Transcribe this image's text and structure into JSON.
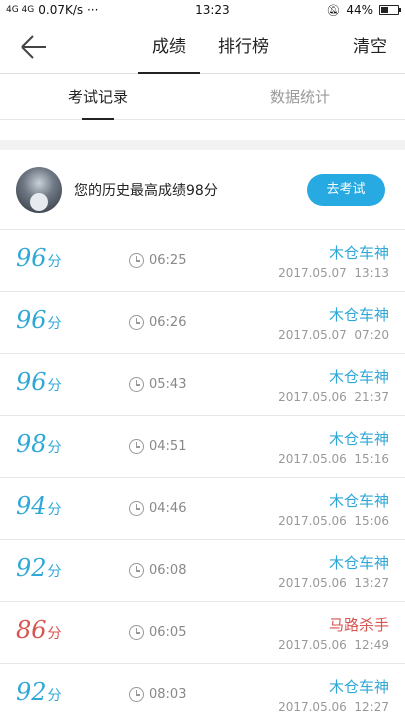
{
  "status_bar": {
    "left_text": "0.07K/s ···",
    "network": "4G 4G",
    "time": "13:23",
    "battery": "44%",
    "battery_level": 0.44
  },
  "nav": {
    "back_icon": "arrow-left-icon",
    "tabs": [
      {
        "label": "成绩",
        "active": true
      },
      {
        "label": "排行榜",
        "active": false
      }
    ],
    "clear_label": "清空"
  },
  "sub_tabs": [
    {
      "label": "考试记录",
      "active": true
    },
    {
      "label": "数据统计",
      "active": false
    }
  ],
  "best": {
    "text": "您的历史最高成绩98分",
    "button": "去考试"
  },
  "records": [
    {
      "score": "96",
      "unit": "分",
      "duration": "06:25",
      "title": "木仓车神",
      "datetime": "2017.05.07  13:13",
      "low": false
    },
    {
      "score": "96",
      "unit": "分",
      "duration": "06:26",
      "title": "木仓车神",
      "datetime": "2017.05.07  07:20",
      "low": false
    },
    {
      "score": "96",
      "unit": "分",
      "duration": "05:43",
      "title": "木仓车神",
      "datetime": "2017.05.06  21:37",
      "low": false
    },
    {
      "score": "98",
      "unit": "分",
      "duration": "04:51",
      "title": "木仓车神",
      "datetime": "2017.05.06  15:16",
      "low": false
    },
    {
      "score": "94",
      "unit": "分",
      "duration": "04:46",
      "title": "木仓车神",
      "datetime": "2017.05.06  15:06",
      "low": false
    },
    {
      "score": "92",
      "unit": "分",
      "duration": "06:08",
      "title": "木仓车神",
      "datetime": "2017.05.06  13:27",
      "low": false
    },
    {
      "score": "86",
      "unit": "分",
      "duration": "06:05",
      "title": "马路杀手",
      "datetime": "2017.05.06  12:49",
      "low": true
    },
    {
      "score": "92",
      "unit": "分",
      "duration": "08:03",
      "title": "木仓车神",
      "datetime": "2017.05.06  12:27",
      "low": false
    }
  ],
  "colors": {
    "accent": "#2fa8d8",
    "button": "#27a9e1",
    "low_score": "#d9534f"
  }
}
